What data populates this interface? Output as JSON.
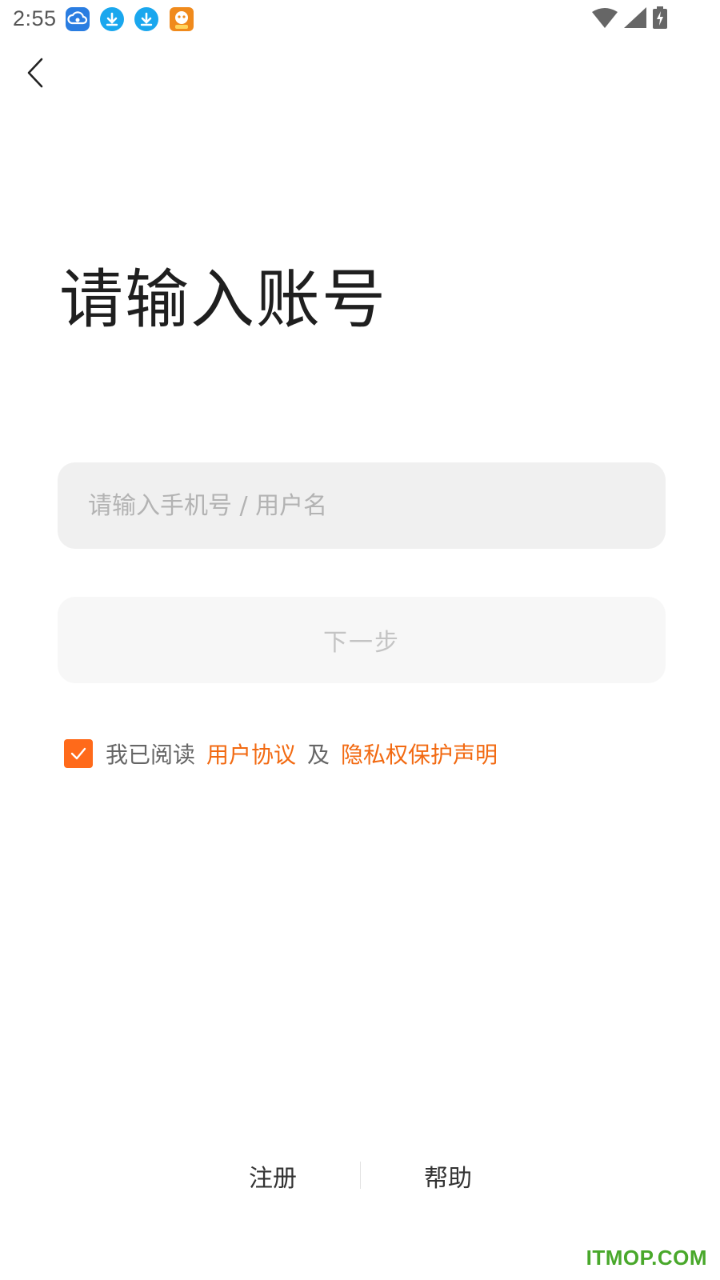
{
  "status_bar": {
    "time": "2:55",
    "notification_icons": [
      "cloud-app-icon",
      "download-icon",
      "download-icon",
      "game-app-icon"
    ],
    "right_icons": [
      "wifi-icon",
      "cellular-signal-icon",
      "battery-charging-icon"
    ]
  },
  "header": {
    "back_icon": "chevron-left-icon"
  },
  "main": {
    "title": "请输入账号",
    "account_input": {
      "placeholder": "请输入手机号 / 用户名",
      "value": ""
    },
    "next_button_label": "下一步"
  },
  "agreement": {
    "checked": true,
    "prefix": "我已阅读",
    "user_agreement": "用户协议",
    "conjunction": "及",
    "privacy_statement": "隐私权保护声明"
  },
  "footer": {
    "register_label": "注册",
    "help_label": "帮助"
  },
  "watermark": "ITMOP.COM",
  "colors": {
    "accent": "#f26a12",
    "checkbox": "#ff6a1a",
    "input_bg": "#f0f0f0",
    "watermark": "#49a82b"
  }
}
